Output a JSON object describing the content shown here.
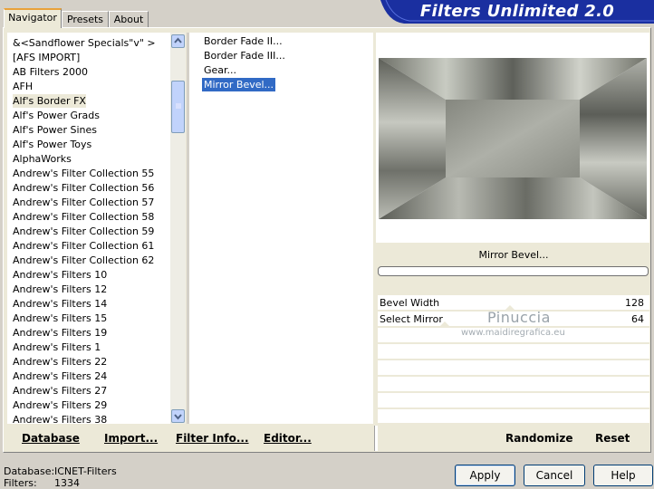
{
  "app": {
    "title": "Filters Unlimited 2.0"
  },
  "tabs": [
    {
      "label": "Navigator",
      "active": true
    },
    {
      "label": "Presets",
      "active": false
    },
    {
      "label": "About",
      "active": false
    }
  ],
  "categories": {
    "selected": "Alf's Border FX",
    "items": [
      "&<Sandflower Specials\"v\" >",
      "[AFS IMPORT]",
      "AB Filters 2000",
      "AFH",
      "Alf's Border FX",
      "Alf's Power Grads",
      "Alf's Power Sines",
      "Alf's Power Toys",
      "AlphaWorks",
      "Andrew's Filter Collection 55",
      "Andrew's Filter Collection 56",
      "Andrew's Filter Collection 57",
      "Andrew's Filter Collection 58",
      "Andrew's Filter Collection 59",
      "Andrew's Filter Collection 61",
      "Andrew's Filter Collection 62",
      "Andrew's Filters 10",
      "Andrew's Filters 12",
      "Andrew's Filters 14",
      "Andrew's Filters 15",
      "Andrew's Filters 19",
      "Andrew's Filters 1",
      "Andrew's Filters 22",
      "Andrew's Filters 24",
      "Andrew's Filters 27",
      "Andrew's Filters 29",
      "Andrew's Filters 38"
    ]
  },
  "filters": {
    "selected": "Mirror Bevel...",
    "items": [
      "Border Fade II...",
      "Border Fade III...",
      "Gear...",
      "Mirror Bevel..."
    ]
  },
  "preview": {
    "filter_name": "Mirror Bevel...",
    "progress": 0
  },
  "params": [
    {
      "label": "Bevel Width",
      "value": "128"
    },
    {
      "label": "Select Mirror",
      "value": "64"
    }
  ],
  "watermark": {
    "name": "Pinuccia",
    "url": "www.maidiregrafica.eu"
  },
  "left_buttons": {
    "database": "Database",
    "import": "Import...",
    "filter_info": "Filter Info...",
    "editor": "Editor..."
  },
  "right_buttons": {
    "randomize": "Randomize",
    "reset": "Reset"
  },
  "status": {
    "database_label": "Database:",
    "database_value": "ICNET-Filters",
    "filters_label": "Filters:",
    "filters_value": "1334"
  },
  "dialog_buttons": {
    "apply": "Apply",
    "cancel": "Cancel",
    "help": "Help"
  },
  "colors": {
    "banner": "#1a2fa0",
    "selection": "#316ac5",
    "window": "#ece9d8"
  }
}
